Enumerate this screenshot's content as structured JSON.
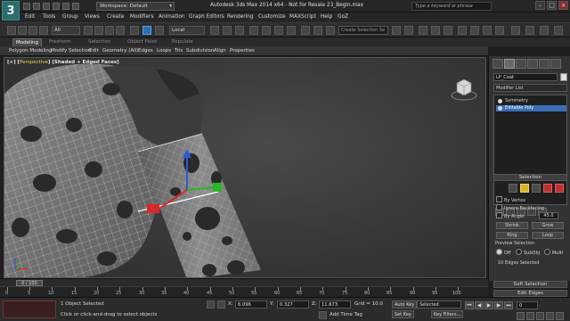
{
  "titlebar": {
    "workspace_label": "Workspace: Default",
    "title": "Autodesk 3ds Max  2014 x64  - Not for Resale   23_Begin.max",
    "search_placeholder": "Type a keyword or phrase",
    "logo_letter": "3"
  },
  "menu": [
    "Edit",
    "Tools",
    "Group",
    "Views",
    "Create",
    "Modifiers",
    "Animation",
    "Graph Editors",
    "Rendering",
    "Customize",
    "MAXScript",
    "Help",
    "GoZ"
  ],
  "toolbar": {
    "selection_filter": "All",
    "ref_coord": "Local",
    "selection_set_placeholder": "Create Selection Se"
  },
  "ribbon": {
    "tabs": [
      "Modeling",
      "Freeform",
      "Selection",
      "Object Paint",
      "Populate"
    ],
    "active_tab": "Modeling",
    "sub_items": [
      "Polygon Modeling",
      "Modify Selection",
      "Edit",
      "Geometry (All)",
      "Edges",
      "Loops",
      "Tris",
      "Subdivision",
      "Align",
      "Properties"
    ]
  },
  "viewport": {
    "label_prefix": "[+] [",
    "label_name": "Perspective",
    "label_suffix": "] [Shaded + Edged Faces]"
  },
  "command_panel": {
    "object_name": "LP_Coat",
    "modifier_list": "Modifier List",
    "stack": [
      {
        "label": "Symmetry",
        "selected": false
      },
      {
        "label": "Editable Poly",
        "selected": true
      }
    ],
    "selection_title": "Selection",
    "by_vertex": "By Vertex",
    "ignore_backfacing": "Ignore Backfacing",
    "by_angle": "By Angle:",
    "by_angle_value": "45.0",
    "shrink": "Shrink",
    "grow": "Grow",
    "ring": "Ring",
    "loop": "Loop",
    "preview_selection": "Preview Selection",
    "preview_options": [
      "Off",
      "SubObj",
      "Multi"
    ],
    "edges_selected": "10 Edges Selected",
    "soft_selection": "Soft Selection",
    "edit_edges": "Edit Edges"
  },
  "timeline": {
    "thumb": "0 / 100",
    "ticks": [
      "0",
      "5",
      "10",
      "15",
      "20",
      "25",
      "30",
      "35",
      "40",
      "45",
      "50",
      "55",
      "60",
      "65",
      "70",
      "75",
      "80",
      "85",
      "90",
      "95",
      "100"
    ]
  },
  "statusbar": {
    "objects_selected": "1 Object Selected",
    "prompt": "Click or click-and-drag to select objects",
    "x_label": "X:",
    "x_value": "6.096",
    "y_label": "Y:",
    "y_value": "0.327",
    "z_label": "Z:",
    "z_value": "11.673",
    "grid": "Grid = 10.0",
    "add_time_tag": "Add Time Tag",
    "auto_key": "Auto Key",
    "set_key": "Set Key",
    "selected_dropdown": "Selected",
    "key_filters": "Key Filters...",
    "frame": "0"
  },
  "colors": {
    "accent_blue": "#3a6fb5",
    "selection_yellow": "#d8b52a",
    "axis_red": "#d62a2a",
    "axis_green": "#2ab52a",
    "axis_blue": "#2a5ad6",
    "app_logo": "#2b6d6d"
  }
}
